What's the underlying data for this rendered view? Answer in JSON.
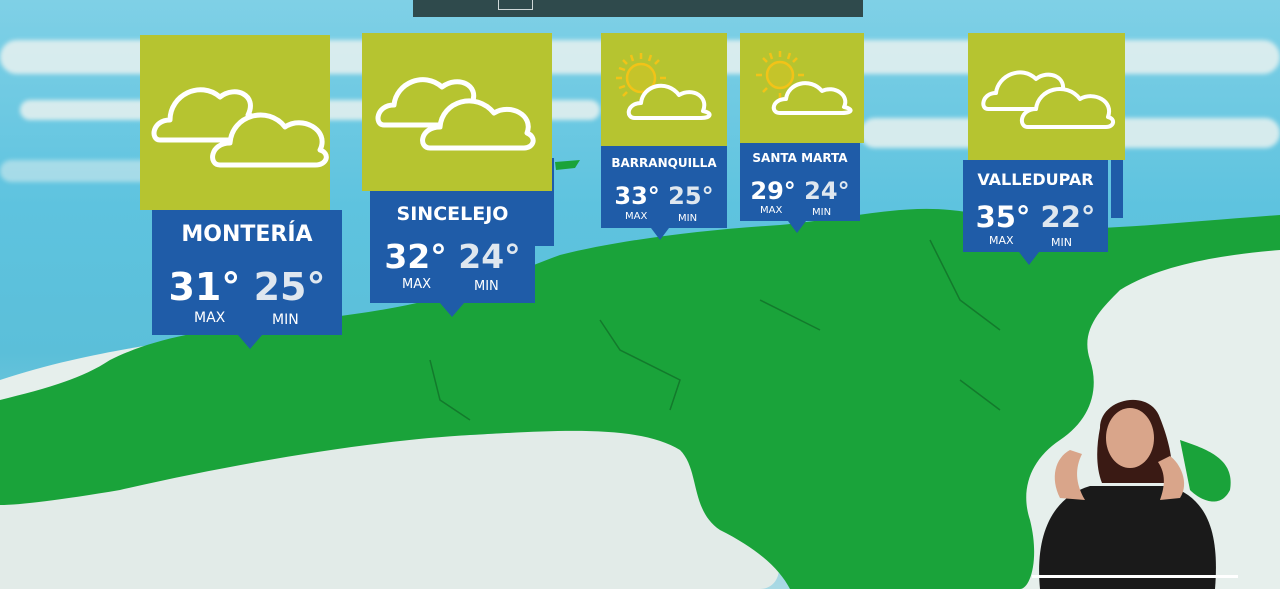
{
  "forecast": [
    {
      "city": "MONTERÍA",
      "max": "31°",
      "min": "25°",
      "max_label": "MAX",
      "min_label": "MIN",
      "icon": "cloudy-icon"
    },
    {
      "city": "SINCELEJO",
      "max": "32°",
      "min": "24°",
      "max_label": "MAX",
      "min_label": "MIN",
      "icon": "cloudy-icon"
    },
    {
      "city": "BARRANQUILLA",
      "max": "33°",
      "min": "25°",
      "max_label": "MAX",
      "min_label": "MIN",
      "icon": "partly-sunny-icon"
    },
    {
      "city": "SANTA MARTA",
      "max": "29°",
      "min": "24°",
      "max_label": "MAX",
      "min_label": "MIN",
      "icon": "partly-sunny-icon"
    },
    {
      "city": "VALLEDUPAR",
      "max": "35°",
      "min": "22°",
      "max_label": "MAX",
      "min_label": "MIN",
      "icon": "cloudy-icon"
    }
  ],
  "colors": {
    "card_top": "#b6c430",
    "card_bottom": "#1f5ca8",
    "land": "#1aa33a",
    "sea": "#5ec3df",
    "neighbor_land": "#e6efec"
  }
}
